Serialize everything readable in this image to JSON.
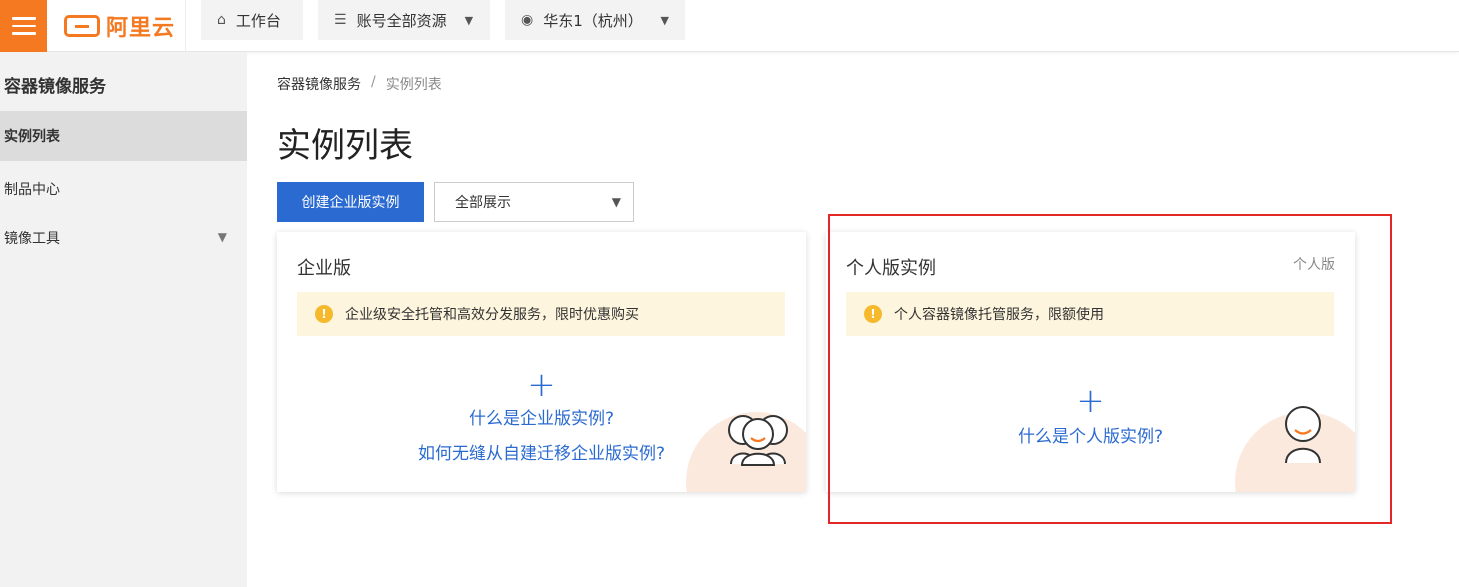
{
  "topbar": {
    "brand": "阿里云",
    "workbench": "工作台",
    "resources": "账号全部资源",
    "region": "华东1（杭州）"
  },
  "sidebar": {
    "title": "容器镜像服务",
    "items": [
      {
        "label": "实例列表"
      },
      {
        "label": "制品中心"
      },
      {
        "label": "镜像工具"
      }
    ]
  },
  "breadcrumb": {
    "root": "容器镜像服务",
    "separator": "/",
    "current": "实例列表"
  },
  "page": {
    "title": "实例列表",
    "create_button": "创建企业版实例",
    "filter_value": "全部展示"
  },
  "cards": {
    "enterprise": {
      "title": "企业版",
      "notice": "企业级安全托管和高效分发服务，限时优惠购买",
      "link1": "什么是企业版实例?",
      "link2": "如何无缝从自建迁移企业版实例?"
    },
    "personal": {
      "title": "个人版实例",
      "tag": "个人版",
      "notice": "个人容器镜像托管服务，限额使用",
      "link1": "什么是个人版实例?"
    }
  },
  "colors": {
    "brand": "#f47920",
    "primary": "#2b6bd1",
    "warning": "#f5b92b",
    "highlight": "#e32626"
  }
}
